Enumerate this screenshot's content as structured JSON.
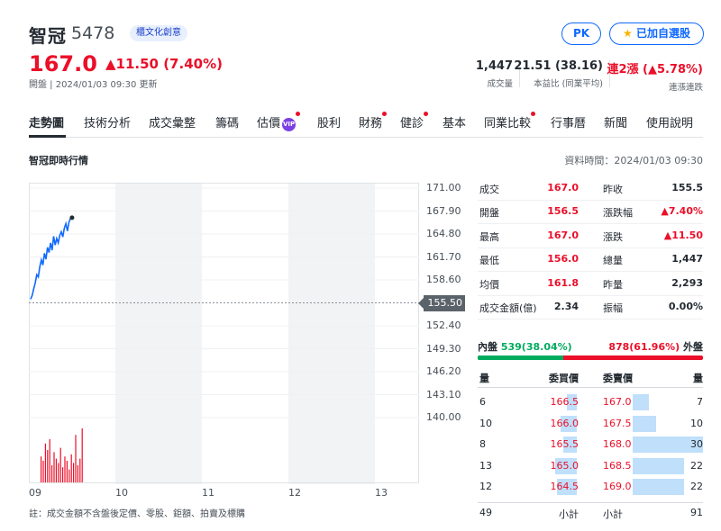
{
  "stock": {
    "name": "智冠",
    "code": "5478",
    "tag": "櫃文化創意",
    "price": "167.0",
    "change": "▲11.50 (7.40%)",
    "meta": "開盤 | 2024/01/03 09:30 更新",
    "pk_label": "PK",
    "watch_label": "已加自選股"
  },
  "stats": [
    {
      "value": "1,447",
      "label": "成交量"
    },
    {
      "value": "21.51 (38.16)",
      "label": "本益比 (同業平均)"
    },
    {
      "value": "連2漲 (▲5.78%)",
      "label": "連漲連跌"
    }
  ],
  "nav": [
    {
      "label": "走勢圖",
      "dot": false
    },
    {
      "label": "技術分析",
      "dot": false
    },
    {
      "label": "成交彙整",
      "dot": false
    },
    {
      "label": "籌碼",
      "dot": false
    },
    {
      "label": "估價",
      "dot": true,
      "badge": "VIP"
    },
    {
      "label": "股利",
      "dot": false
    },
    {
      "label": "財務",
      "dot": true
    },
    {
      "label": "健診",
      "dot": true
    },
    {
      "label": "基本",
      "dot": false
    },
    {
      "label": "同業比較",
      "dot": true
    },
    {
      "label": "行事曆",
      "dot": false
    },
    {
      "label": "新聞",
      "dot": false
    },
    {
      "label": "使用說明",
      "dot": false
    }
  ],
  "section": {
    "title": "智冠即時行情",
    "data_time": "資料時間：2024/01/03 09:30"
  },
  "chart_data": {
    "type": "line",
    "x_ticks": [
      "09",
      "10",
      "11",
      "12",
      "13"
    ],
    "y_ticks": [
      "171.00",
      "167.90",
      "164.80",
      "161.70",
      "158.60",
      "152.40",
      "149.30",
      "146.20",
      "143.10",
      "140.00"
    ],
    "ylim": [
      140.0,
      171.0
    ],
    "reference_price": "155.50",
    "series": [
      {
        "values": [
          156.0,
          156.5,
          157.4,
          158.2,
          159.3,
          159.0,
          160.4,
          161.3,
          160.6,
          162.2,
          161.4,
          163.0,
          162.3,
          163.6,
          162.6,
          164.5,
          163.3,
          164.2,
          163.6,
          164.6,
          165.1,
          164.4,
          165.6,
          166.2,
          165.2,
          166.4,
          166.9,
          167.0
        ]
      }
    ],
    "volume_bars": [
      12,
      10,
      18,
      15,
      20,
      8,
      14,
      11,
      9,
      16,
      7,
      12,
      10,
      6,
      13,
      9,
      22,
      8,
      11,
      25
    ]
  },
  "quote": {
    "rows": [
      {
        "l1": "成交",
        "v1": "167.0",
        "c1": "up",
        "l2": "昨收",
        "v2": "155.5",
        "c2": ""
      },
      {
        "l1": "開盤",
        "v1": "156.5",
        "c1": "up",
        "l2": "漲跌幅",
        "v2": "▲7.40%",
        "c2": "up"
      },
      {
        "l1": "最高",
        "v1": "167.0",
        "c1": "up",
        "l2": "漲跌",
        "v2": "▲11.50",
        "c2": "up"
      },
      {
        "l1": "最低",
        "v1": "156.0",
        "c1": "up",
        "l2": "總量",
        "v2": "1,447",
        "c2": ""
      },
      {
        "l1": "均價",
        "v1": "161.8",
        "c1": "up",
        "l2": "昨量",
        "v2": "2,293",
        "c2": ""
      },
      {
        "l1": "成交金額(億)",
        "v1": "2.34",
        "c1": "",
        "l2": "振幅",
        "v2": "0.00%",
        "c2": ""
      }
    ],
    "inner_label": "內盤",
    "inner_value": "539(38.04%)",
    "outer_label": "外盤",
    "outer_value": "878(61.96%)",
    "inner_ratio": 0.3804
  },
  "orderbook": {
    "headers": {
      "bid_qty": "量",
      "bid_price": "委買價",
      "ask_price": "委賣價",
      "ask_qty": "量"
    },
    "rows": [
      {
        "bid_qty": "6",
        "bid_price": "166.5",
        "ask_price": "167.0",
        "ask_qty": "7"
      },
      {
        "bid_qty": "10",
        "bid_price": "166.0",
        "ask_price": "167.5",
        "ask_qty": "10"
      },
      {
        "bid_qty": "8",
        "bid_price": "165.5",
        "ask_price": "168.0",
        "ask_qty": "30"
      },
      {
        "bid_qty": "13",
        "bid_price": "165.0",
        "ask_price": "168.5",
        "ask_qty": "22"
      },
      {
        "bid_qty": "12",
        "bid_price": "164.5",
        "ask_price": "169.0",
        "ask_qty": "22"
      }
    ],
    "bid_total": "49",
    "bid_total_label": "小計",
    "ask_total_label": "小計",
    "ask_total": "91"
  },
  "footnote": "註：成交金額不含盤後定價、零股、鉅額、拍賣及標購",
  "colors": {
    "up": "#eb0f29",
    "down": "#00ab5e",
    "line": "#0f69ff",
    "bar": "#bfdffb"
  }
}
